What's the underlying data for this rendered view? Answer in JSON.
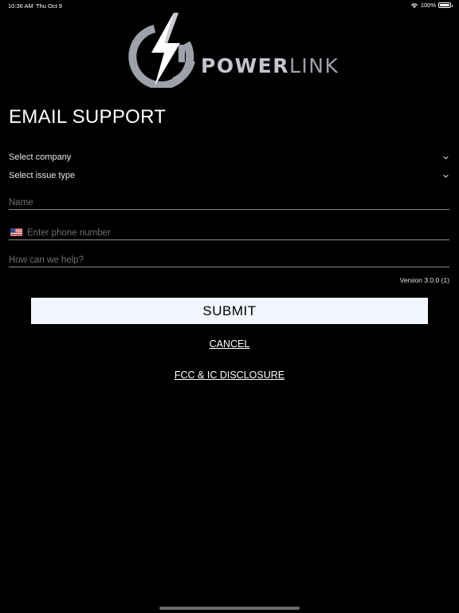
{
  "status_bar": {
    "time": "10:36 AM",
    "date": "Thu Oct 9",
    "battery": "100%"
  },
  "logo": {
    "text_bold": "POWER",
    "text_light": "LINK"
  },
  "page": {
    "title": "EMAIL SUPPORT"
  },
  "form": {
    "company_select": {
      "label": "Select company"
    },
    "issue_select": {
      "label": "Select issue type"
    },
    "name_field": {
      "placeholder": "Name",
      "value": ""
    },
    "phone_field": {
      "placeholder": "Enter phone number",
      "value": ""
    },
    "help_field": {
      "placeholder": "How can we help?",
      "value": ""
    }
  },
  "version": "Version 3.0.0 (1)",
  "actions": {
    "submit_label": "SUBMIT",
    "cancel_label": "CANCEL",
    "disclosure_label": "FCC & IC DISCLOSURE"
  },
  "colors": {
    "background": "#000000",
    "submit_bg": "#f2f7ff",
    "logo_gray": "#b9bcc4"
  }
}
